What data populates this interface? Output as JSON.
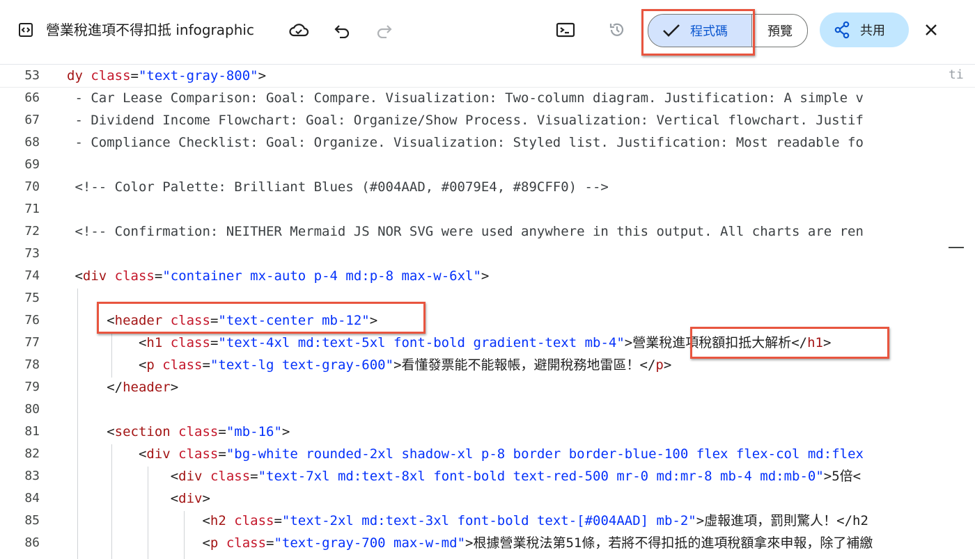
{
  "toolbar": {
    "title": "營業稅進項不得扣抵 infographic",
    "code_label": "程式碼",
    "preview_label": "預覽",
    "share_label": "共用"
  },
  "editor": {
    "lines": [
      {
        "n": "53",
        "parts": [
          [
            "tag",
            "dy "
          ],
          [
            "attr",
            "class"
          ],
          [
            "txt",
            "="
          ],
          [
            "str",
            "\"text-gray-800\""
          ],
          [
            "txt",
            ">"
          ]
        ]
      },
      {
        "n": "66",
        "parts": [
          [
            "cm",
            " - Car Lease Comparison: Goal: Compare. Visualization: Two-column diagram. Justification: A simple v"
          ]
        ]
      },
      {
        "n": "67",
        "parts": [
          [
            "cm",
            " - Dividend Income Flowchart: Goal: Organize/Show Process. Visualization: Vertical flowchart. Justif"
          ]
        ]
      },
      {
        "n": "68",
        "parts": [
          [
            "cm",
            " - Compliance Checklist: Goal: Organize. Visualization: Styled list. Justification: Most readable fo"
          ]
        ]
      },
      {
        "n": "69",
        "parts": []
      },
      {
        "n": "70",
        "parts": [
          [
            "cm",
            " <!-- Color Palette: Brilliant Blues (#004AAD, #0079E4, #89CFF0) -->"
          ]
        ]
      },
      {
        "n": "71",
        "parts": []
      },
      {
        "n": "72",
        "parts": [
          [
            "cm",
            " <!-- Confirmation: NEITHER Mermaid JS NOR SVG were used anywhere in this output. All charts are ren"
          ]
        ]
      },
      {
        "n": "73",
        "parts": []
      },
      {
        "n": "74",
        "parts": [
          [
            "txt",
            " <"
          ],
          [
            "tag",
            "div"
          ],
          [
            "txt",
            " "
          ],
          [
            "attr",
            "class"
          ],
          [
            "txt",
            "="
          ],
          [
            "str",
            "\"container mx-auto p-4 md:p-8 max-w-6xl\""
          ],
          [
            "txt",
            ">"
          ]
        ]
      },
      {
        "n": "75",
        "parts": []
      },
      {
        "n": "76",
        "parts": [
          [
            "txt",
            "     <"
          ],
          [
            "tag",
            "header"
          ],
          [
            "txt",
            " "
          ],
          [
            "attr",
            "class"
          ],
          [
            "txt",
            "="
          ],
          [
            "str",
            "\"text-center mb-12\""
          ],
          [
            "txt",
            ">"
          ]
        ]
      },
      {
        "n": "77",
        "parts": [
          [
            "txt",
            "         <"
          ],
          [
            "tag",
            "h1"
          ],
          [
            "txt",
            " "
          ],
          [
            "attr",
            "class"
          ],
          [
            "txt",
            "="
          ],
          [
            "str",
            "\"text-4xl md:text-5xl font-bold gradient-text mb-4\""
          ],
          [
            "txt",
            ">營業稅進項稅額扣抵大解析</"
          ],
          [
            "tag",
            "h1"
          ],
          [
            "txt",
            ">"
          ]
        ]
      },
      {
        "n": "78",
        "parts": [
          [
            "txt",
            "         <"
          ],
          [
            "tag",
            "p"
          ],
          [
            "txt",
            " "
          ],
          [
            "attr",
            "class"
          ],
          [
            "txt",
            "="
          ],
          [
            "str",
            "\"text-lg text-gray-600\""
          ],
          [
            "txt",
            ">看懂發票能不能報帳，避開稅務地雷區！</"
          ],
          [
            "tag",
            "p"
          ],
          [
            "txt",
            ">"
          ]
        ]
      },
      {
        "n": "79",
        "parts": [
          [
            "txt",
            "     </"
          ],
          [
            "tag",
            "header"
          ],
          [
            "txt",
            ">"
          ]
        ]
      },
      {
        "n": "80",
        "parts": []
      },
      {
        "n": "81",
        "parts": [
          [
            "txt",
            "     <"
          ],
          [
            "tag",
            "section"
          ],
          [
            "txt",
            " "
          ],
          [
            "attr",
            "class"
          ],
          [
            "txt",
            "="
          ],
          [
            "str",
            "\"mb-16\""
          ],
          [
            "txt",
            ">"
          ]
        ]
      },
      {
        "n": "82",
        "parts": [
          [
            "txt",
            "         <"
          ],
          [
            "tag",
            "div"
          ],
          [
            "txt",
            " "
          ],
          [
            "attr",
            "class"
          ],
          [
            "txt",
            "="
          ],
          [
            "str",
            "\"bg-white rounded-2xl shadow-xl p-8 border border-blue-100 flex flex-col md:flex"
          ]
        ]
      },
      {
        "n": "83",
        "parts": [
          [
            "txt",
            "             <"
          ],
          [
            "tag",
            "div"
          ],
          [
            "txt",
            " "
          ],
          [
            "attr",
            "class"
          ],
          [
            "txt",
            "="
          ],
          [
            "str",
            "\"text-7xl md:text-8xl font-bold text-red-500 mr-0 md:mr-8 mb-4 md:mb-0\""
          ],
          [
            "txt",
            ">5倍<"
          ]
        ]
      },
      {
        "n": "84",
        "parts": [
          [
            "txt",
            "             <"
          ],
          [
            "tag",
            "div"
          ],
          [
            "txt",
            ">"
          ]
        ]
      },
      {
        "n": "85",
        "parts": [
          [
            "txt",
            "                 <"
          ],
          [
            "tag",
            "h2"
          ],
          [
            "txt",
            " "
          ],
          [
            "attr",
            "class"
          ],
          [
            "txt",
            "="
          ],
          [
            "str",
            "\"text-2xl md:text-3xl font-bold text-[#004AAD] mb-2\""
          ],
          [
            "txt",
            ">虛報進項，罰則驚人！</h2"
          ]
        ]
      },
      {
        "n": "86",
        "parts": [
          [
            "txt",
            "                 <"
          ],
          [
            "tag",
            "p"
          ],
          [
            "txt",
            " "
          ],
          [
            "attr",
            "class"
          ],
          [
            "txt",
            "="
          ],
          [
            "str",
            "\"text-gray-700 max-w-md\""
          ],
          [
            "txt",
            ">根據營業稅法第51條，若將不得扣抵的進項稅額拿來申報，除了補繳"
          ]
        ]
      }
    ]
  }
}
